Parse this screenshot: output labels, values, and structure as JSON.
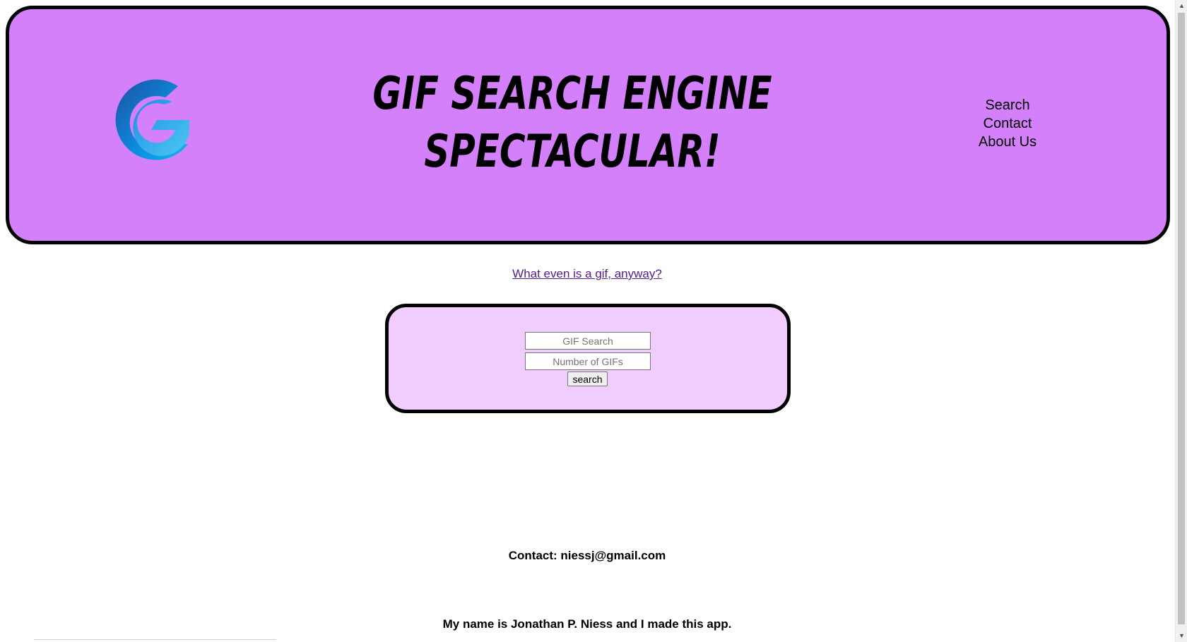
{
  "header": {
    "title": "GIF SEARCH ENGINE SPECTACULAR!",
    "logo_icon": "g-logo-icon",
    "nav": [
      {
        "label": "Search"
      },
      {
        "label": "Contact"
      },
      {
        "label": "About Us"
      }
    ],
    "colors": {
      "background": "#d580fb",
      "border": "#000000"
    }
  },
  "info_link": "What even is a gif, anyway?",
  "search_form": {
    "gif_search_placeholder": "GIF Search",
    "number_placeholder": "Number of GIFs",
    "button_label": "search",
    "background": "#f0ccff"
  },
  "contact": "Contact: niessj@gmail.com",
  "about": "My name is Jonathan P. Niess and I made this app.",
  "link_color": "#551a8b"
}
